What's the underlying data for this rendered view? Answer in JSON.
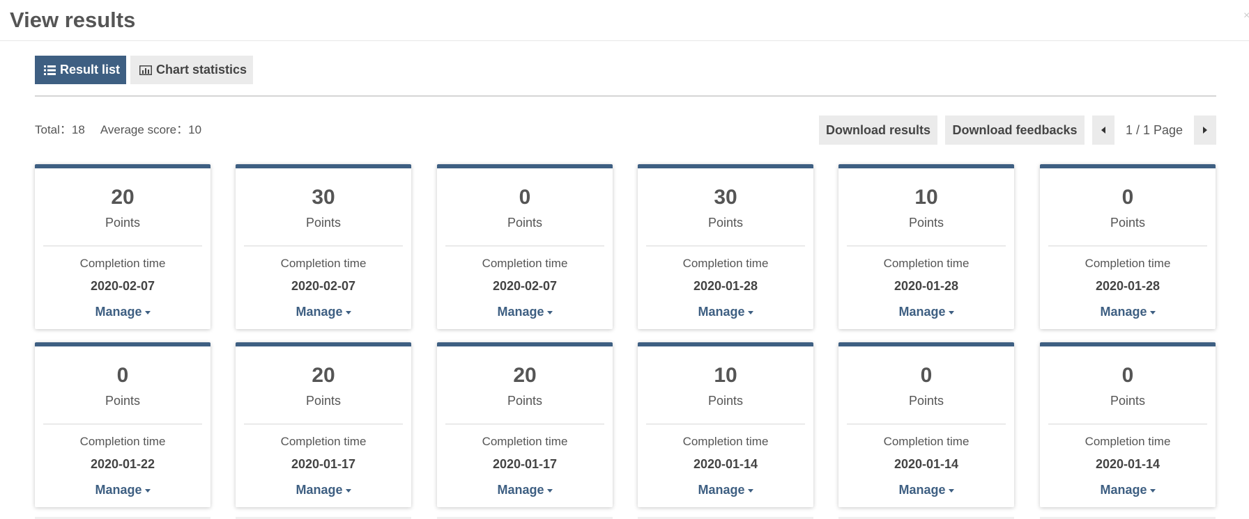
{
  "page": {
    "title": "View results"
  },
  "tabs": {
    "result_list": "Result list",
    "chart_statistics": "Chart statistics"
  },
  "summary": {
    "total": "Total：18",
    "average": "Average score：10"
  },
  "toolbar": {
    "download_results": "Download results",
    "download_feedbacks": "Download feedbacks",
    "page_indicator": "1 / 1 Page"
  },
  "card_labels": {
    "points": "Points",
    "completion_time": "Completion time",
    "manage": "Manage"
  },
  "results": [
    {
      "score": "20",
      "date": "2020-02-07"
    },
    {
      "score": "30",
      "date": "2020-02-07"
    },
    {
      "score": "0",
      "date": "2020-02-07"
    },
    {
      "score": "30",
      "date": "2020-01-28"
    },
    {
      "score": "10",
      "date": "2020-01-28"
    },
    {
      "score": "0",
      "date": "2020-01-28"
    },
    {
      "score": "0",
      "date": "2020-01-22"
    },
    {
      "score": "20",
      "date": "2020-01-17"
    },
    {
      "score": "20",
      "date": "2020-01-17"
    },
    {
      "score": "10",
      "date": "2020-01-14"
    },
    {
      "score": "0",
      "date": "2020-01-14"
    },
    {
      "score": "0",
      "date": "2020-01-14"
    }
  ],
  "colors": {
    "accent": "#3e5f82",
    "button_bg": "#ebebeb",
    "text": "#555555"
  },
  "icons": {
    "result_list": "list-icon",
    "chart_statistics": "bar-chart-icon",
    "prev": "caret-left-icon",
    "next": "caret-right-icon",
    "manage": "caret-down-icon"
  }
}
